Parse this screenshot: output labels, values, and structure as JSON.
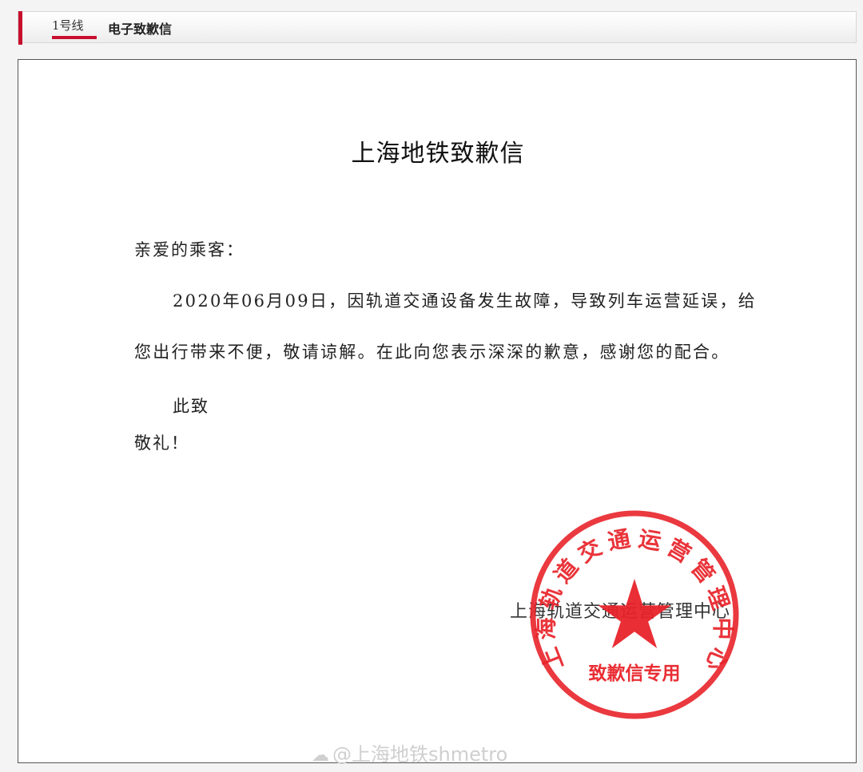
{
  "header": {
    "tab_line": "1号线",
    "tab_title": "电子致歉信"
  },
  "letter": {
    "title": "上海地铁致歉信",
    "salutation": "亲爱的乘客：",
    "body_line1": "2020年06月09日，因轨道交通设备发生故障，导致列车运营延误，给",
    "body_line2": "您出行带来不便，敬请谅解。在此向您表示深深的歉意，感谢您的配合。",
    "closing1": "此致",
    "closing2": "敬礼！",
    "signature": "上海轨道交通运营管理中心"
  },
  "seal": {
    "arc_text": "上海轨道交通运营管理中心",
    "bottom_text": "致歉信专用",
    "color": "#e8232a"
  },
  "watermark": {
    "text": "@上海地铁shmetro"
  },
  "colors": {
    "accent": "#c8102e"
  }
}
